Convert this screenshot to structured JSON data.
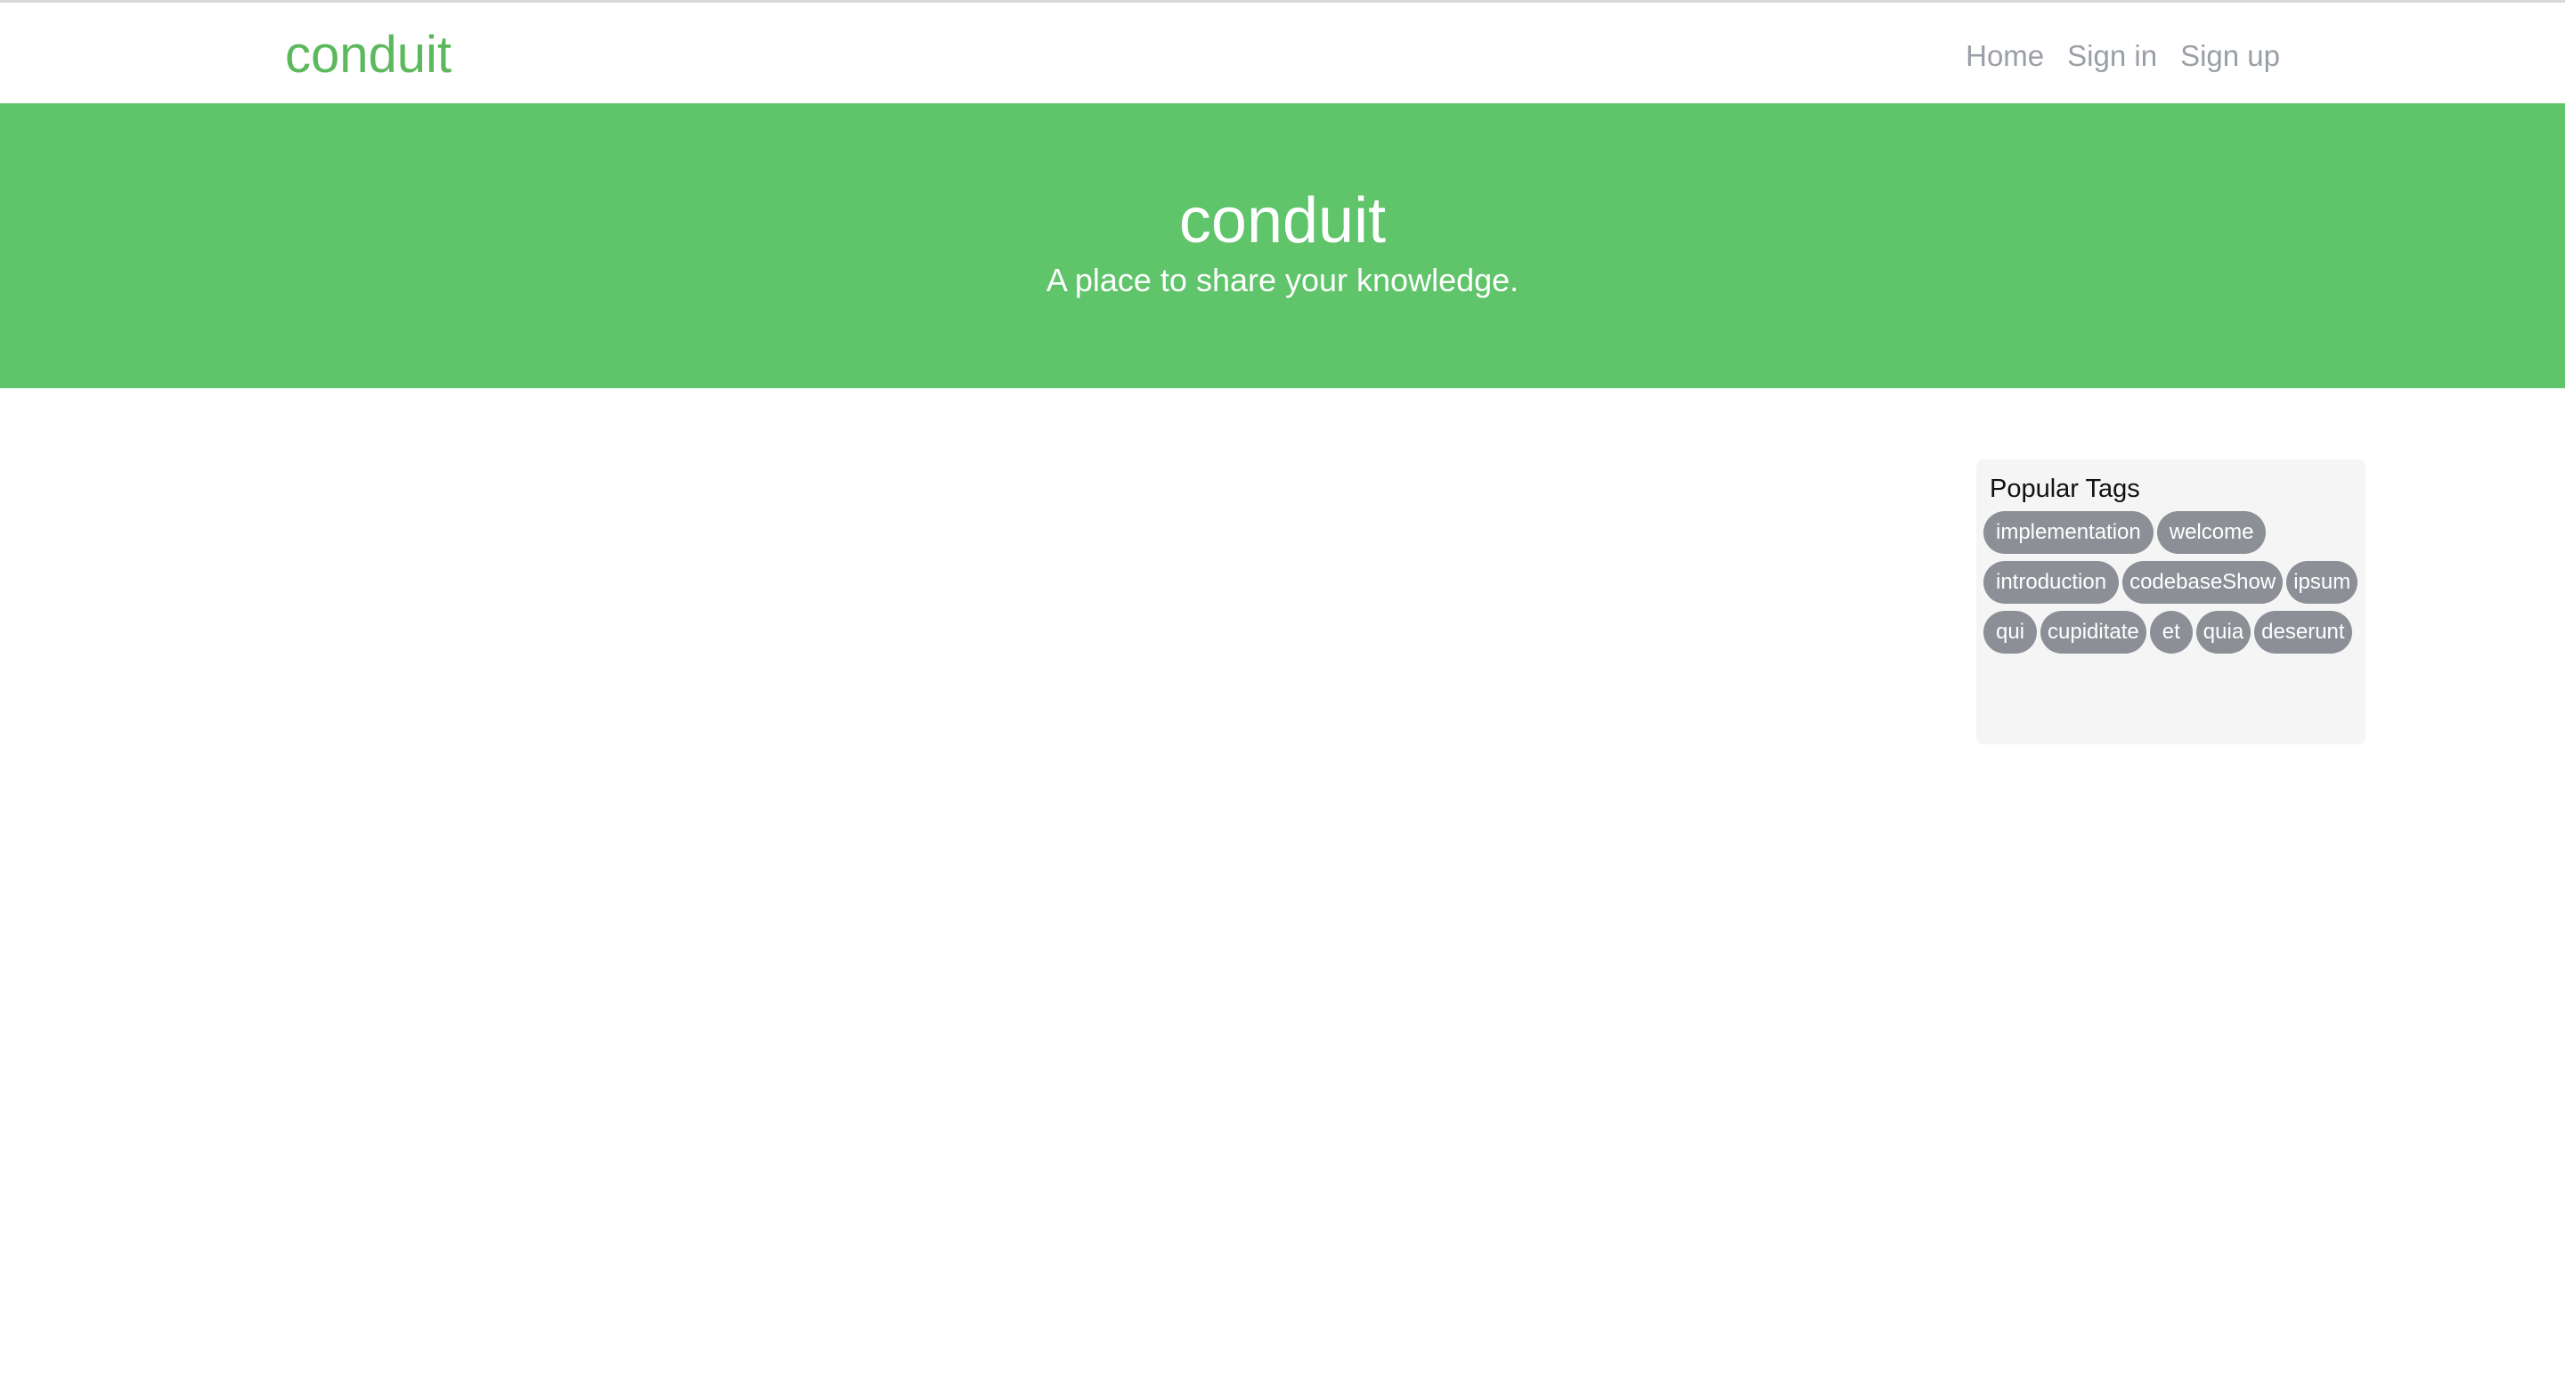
{
  "navbar": {
    "brand": "conduit",
    "links": [
      "Home",
      "Sign in",
      "Sign up"
    ]
  },
  "banner": {
    "title": "conduit",
    "subtitle": "A place to share your knowledge."
  },
  "sidebar": {
    "title": "Popular Tags",
    "tags": [
      "implementation",
      "welcome",
      "introduction",
      "codebaseShow",
      "ipsum",
      "qui",
      "cupiditate",
      "et",
      "quia",
      "deserunt"
    ]
  },
  "colors": {
    "brand": "#5cb85c",
    "banner_bg": "#5fc46a",
    "tag_bg": "#8c8f96",
    "sidebar_bg": "#f5f5f6",
    "nav_link": "#9a9ea6"
  }
}
